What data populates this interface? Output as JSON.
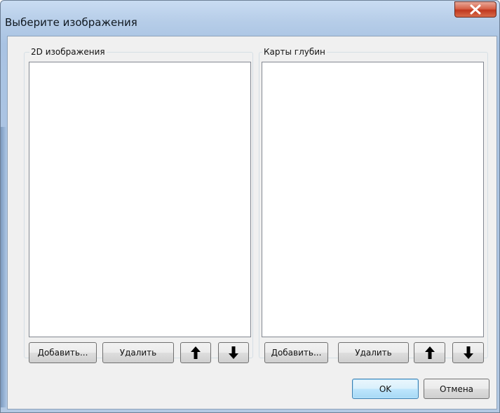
{
  "window": {
    "title": "Выберите изображения",
    "close_icon": "close-x-icon",
    "colors": {
      "titlebar": "#b6cde8",
      "close": "#c0381f",
      "client": "#f0f0f0",
      "default_button": "#bee6fd"
    }
  },
  "images_panel": {
    "label": "2D изображения",
    "items": [],
    "add_label": "Добавить...",
    "remove_label": "Удалить",
    "up_icon": "arrow-up-icon",
    "down_icon": "arrow-down-icon"
  },
  "depth_panel": {
    "label": "Карты глубин",
    "items": [],
    "add_label": "Добавить...",
    "remove_label": "Удалить",
    "up_icon": "arrow-up-icon",
    "down_icon": "arrow-down-icon"
  },
  "footer": {
    "ok_label": "OK",
    "cancel_label": "Отмена"
  }
}
